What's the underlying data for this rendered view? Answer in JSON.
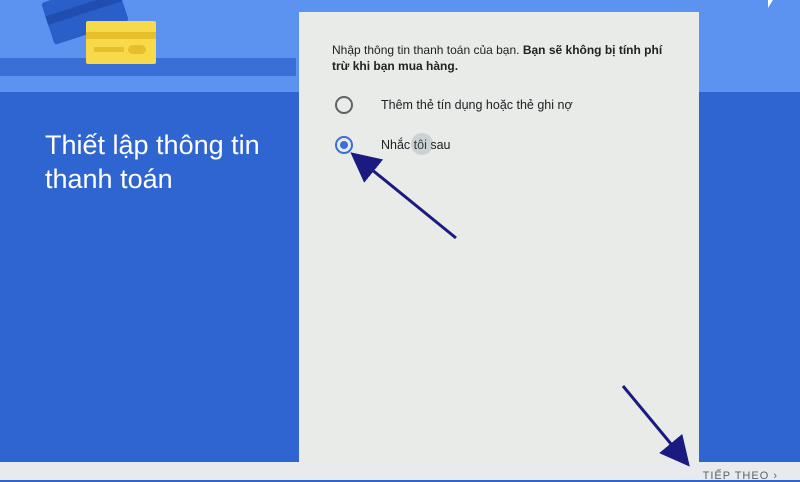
{
  "header": {
    "title": "Thiết lập thông tin thanh toán"
  },
  "form": {
    "intro_text": "Nhập thông tin thanh toán của bạn.",
    "intro_bold": "Bạn sẽ không bị tính phí trừ khi bạn mua hàng.",
    "options": [
      {
        "label": "Thêm thẻ tín dụng hoặc thẻ ghi nợ",
        "selected": false
      },
      {
        "label": "Nhắc tôi sau",
        "selected": true
      }
    ]
  },
  "footer": {
    "next_label": "TIẾP THEO"
  },
  "colors": {
    "background": "#2f65d0",
    "top_band": "#5d93f0",
    "panel": "#e9ebe8",
    "accent": "#3a6fd8",
    "card": "#f7d94a",
    "annotation_arrow": "#1a1a80"
  },
  "icons": [
    "credit-card-icon",
    "cursor-icon",
    "chevron-right-icon"
  ]
}
